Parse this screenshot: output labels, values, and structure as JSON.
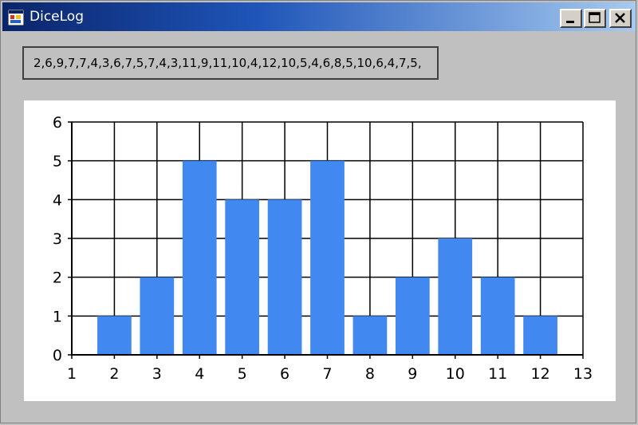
{
  "window": {
    "title": "DiceLog",
    "icon": "app-window-icon",
    "controls": [
      "minimize-icon",
      "maximize-icon",
      "close-icon"
    ]
  },
  "log": {
    "text": "2,6,9,7,7,4,3,6,7,5,7,4,3,11,9,11,10,4,12,10,5,4,6,8,5,10,6,4,7,5,"
  },
  "chart_data": {
    "type": "bar",
    "categories": [
      2,
      3,
      4,
      5,
      6,
      7,
      8,
      9,
      10,
      11,
      12
    ],
    "values": [
      1,
      2,
      5,
      4,
      4,
      5,
      1,
      2,
      3,
      2,
      1
    ],
    "xlim": [
      1,
      13
    ],
    "ylim": [
      0,
      6
    ],
    "xticks": [
      "1",
      "2",
      "3",
      "4",
      "5",
      "6",
      "7",
      "8",
      "9",
      "10",
      "11",
      "12",
      "13"
    ],
    "yticks": [
      "0",
      "1",
      "2",
      "3",
      "4",
      "5",
      "6"
    ],
    "grid": true,
    "color": "#4189f0",
    "title": "",
    "xlabel": "",
    "ylabel": ""
  }
}
